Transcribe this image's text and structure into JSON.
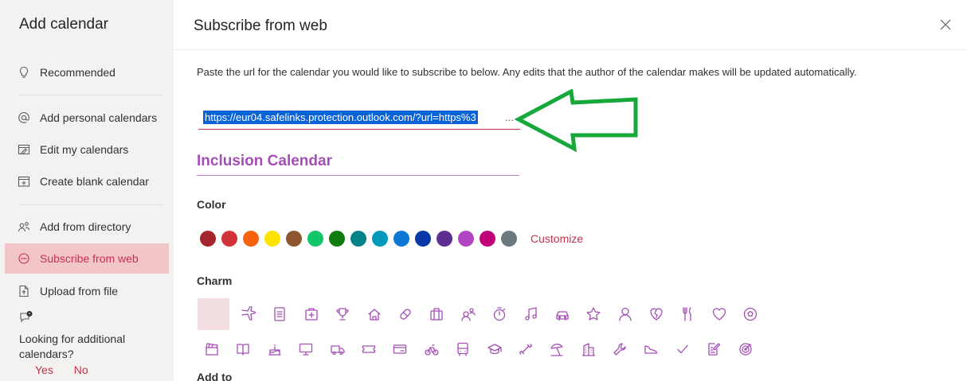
{
  "sidebar": {
    "title": "Add calendar",
    "items": [
      {
        "label": "Recommended",
        "icon": "lightbulb-icon"
      },
      {
        "label": "Add personal calendars",
        "icon": "at-icon"
      },
      {
        "label": "Edit my calendars",
        "icon": "edit-calendar-icon"
      },
      {
        "label": "Create blank calendar",
        "icon": "add-calendar-icon"
      },
      {
        "label": "Add from directory",
        "icon": "people-search-icon"
      },
      {
        "label": "Subscribe from web",
        "icon": "globe-icon",
        "active": true
      },
      {
        "label": "Upload from file",
        "icon": "file-upload-icon"
      }
    ],
    "help": {
      "icon": "chat-info-icon",
      "text": "Looking for additional calendars?",
      "yes": "Yes",
      "no": "No"
    }
  },
  "main": {
    "title": "Subscribe from web",
    "description": "Paste the url for the calendar you would like to subscribe to below. Any edits that the author of the calendar makes will be updated automatically.",
    "url_value": "https://eur04.safelinks.protection.outlook.com/?url=https%3",
    "url_ellipsis": "...",
    "calendar_name": "Inclusion Calendar",
    "color_label": "Color",
    "colors": [
      "#a4262c",
      "#d13438",
      "#f7630c",
      "#fde300",
      "#8e562e",
      "#13c569",
      "#107c10",
      "#038387",
      "#0099bc",
      "#0f78d4",
      "#0838a8",
      "#5c2e91",
      "#b146c2",
      "#bf0077",
      "#69797e"
    ],
    "customize_label": "Customize",
    "charm_label": "Charm",
    "add_to_label": "Add to",
    "accent_color": "#a44fb5",
    "brand_color": "#c4314b",
    "charms_row1": [
      "airplane-icon",
      "notepad-icon",
      "first-aid-icon",
      "trophy-icon",
      "home-icon",
      "pill-icon",
      "briefcase-icon",
      "people-icon",
      "stopwatch-icon",
      "music-note-icon",
      "car-icon",
      "star-icon",
      "person-icon",
      "heart-broken-icon",
      "fork-knife-icon",
      "heart-icon",
      "soccer-ball-icon"
    ],
    "charms_row2": [
      "clapperboard-icon",
      "book-icon",
      "cake-icon",
      "monitor-icon",
      "truck-icon",
      "ticket-icon",
      "credit-card-icon",
      "bicycle-icon",
      "bus-icon",
      "graduation-cap-icon",
      "dumbbell-icon",
      "beach-umbrella-icon",
      "building-icon",
      "wrench-icon",
      "shoe-icon",
      "checkmark-icon",
      "clipboard-edit-icon",
      "target-icon"
    ]
  }
}
